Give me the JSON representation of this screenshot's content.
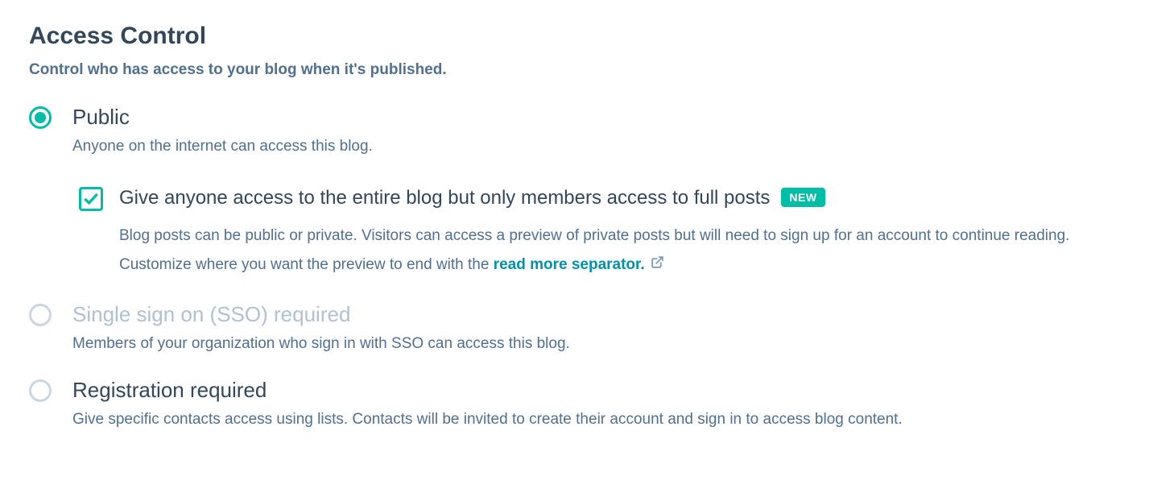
{
  "section": {
    "title": "Access Control",
    "subtitle": "Control who has access to your blog when it's published."
  },
  "options": {
    "public": {
      "label": "Public",
      "description": "Anyone on the internet can access this blog.",
      "nested": {
        "label": "Give anyone access to the entire blog but only members access to full posts",
        "badge": "NEW",
        "description_part1": "Blog posts can be public or private. Visitors can access a preview of private posts but will need to sign up for an account to continue reading. Customize where you want the preview to end with the ",
        "link_text": "read more separator."
      }
    },
    "sso": {
      "label": "Single sign on (SSO) required",
      "description": "Members of your organization who sign in with SSO can access this blog."
    },
    "registration": {
      "label": "Registration required",
      "description": "Give specific contacts access using lists. Contacts will be invited to create their account and sign in to access blog content."
    }
  }
}
